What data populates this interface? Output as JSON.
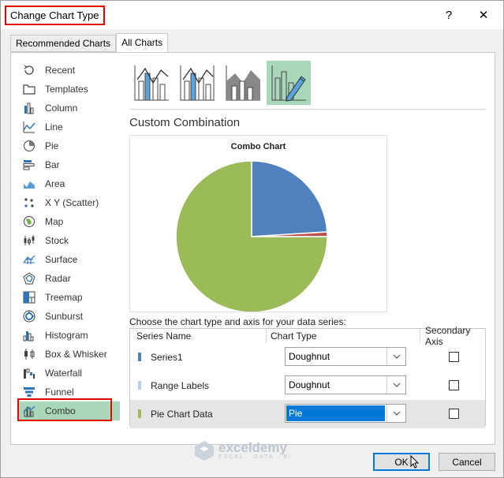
{
  "window": {
    "title": "Change Chart Type",
    "help_label": "?",
    "close_label": "✕"
  },
  "tabs": [
    {
      "label": "Recommended Charts",
      "active": false
    },
    {
      "label": "All Charts",
      "active": true
    }
  ],
  "sidebar": {
    "items": [
      {
        "label": "Recent",
        "icon": "recent-icon"
      },
      {
        "label": "Templates",
        "icon": "templates-icon"
      },
      {
        "label": "Column",
        "icon": "column-chart-icon"
      },
      {
        "label": "Line",
        "icon": "line-chart-icon"
      },
      {
        "label": "Pie",
        "icon": "pie-chart-icon"
      },
      {
        "label": "Bar",
        "icon": "bar-chart-icon"
      },
      {
        "label": "Area",
        "icon": "area-chart-icon"
      },
      {
        "label": "X Y (Scatter)",
        "icon": "scatter-chart-icon"
      },
      {
        "label": "Map",
        "icon": "map-chart-icon"
      },
      {
        "label": "Stock",
        "icon": "stock-chart-icon"
      },
      {
        "label": "Surface",
        "icon": "surface-chart-icon"
      },
      {
        "label": "Radar",
        "icon": "radar-chart-icon"
      },
      {
        "label": "Treemap",
        "icon": "treemap-chart-icon"
      },
      {
        "label": "Sunburst",
        "icon": "sunburst-chart-icon"
      },
      {
        "label": "Histogram",
        "icon": "histogram-chart-icon"
      },
      {
        "label": "Box & Whisker",
        "icon": "box-whisker-chart-icon"
      },
      {
        "label": "Waterfall",
        "icon": "waterfall-chart-icon"
      },
      {
        "label": "Funnel",
        "icon": "funnel-chart-icon"
      },
      {
        "label": "Combo",
        "icon": "combo-chart-icon",
        "selected": true
      }
    ]
  },
  "main": {
    "section_title": "Custom Combination",
    "preview_title": "Combo Chart",
    "series_prompt": "Choose the chart type and axis for your data series:",
    "columns": {
      "series_name": "Series Name",
      "chart_type": "Chart Type",
      "secondary_axis": "Secondary Axis"
    },
    "series": [
      {
        "name": "Series1",
        "chart_type": "Doughnut",
        "secondary_axis": false,
        "color": "#4f81bd"
      },
      {
        "name": "Range Labels",
        "chart_type": "Doughnut",
        "secondary_axis": false,
        "color": "#b9cde5"
      },
      {
        "name": "Pie Chart Data",
        "chart_type": "Pie",
        "secondary_axis": false,
        "color": "#9bbb59",
        "selected": true
      }
    ]
  },
  "chart_data": {
    "type": "pie",
    "title": "Combo Chart",
    "values": [
      0.24,
      0.01,
      0.75
    ],
    "colors": [
      "#4f81bd",
      "#c0504d",
      "#9bbb59"
    ]
  },
  "watermark": {
    "name": "exceldemy",
    "tagline": "EXCEL · DATA · BI"
  },
  "buttons": {
    "ok": "OK",
    "cancel": "Cancel"
  },
  "colors": {
    "accent": "#0078d7",
    "selection": "#a8d8b9",
    "highlight_red": "#e00000"
  }
}
